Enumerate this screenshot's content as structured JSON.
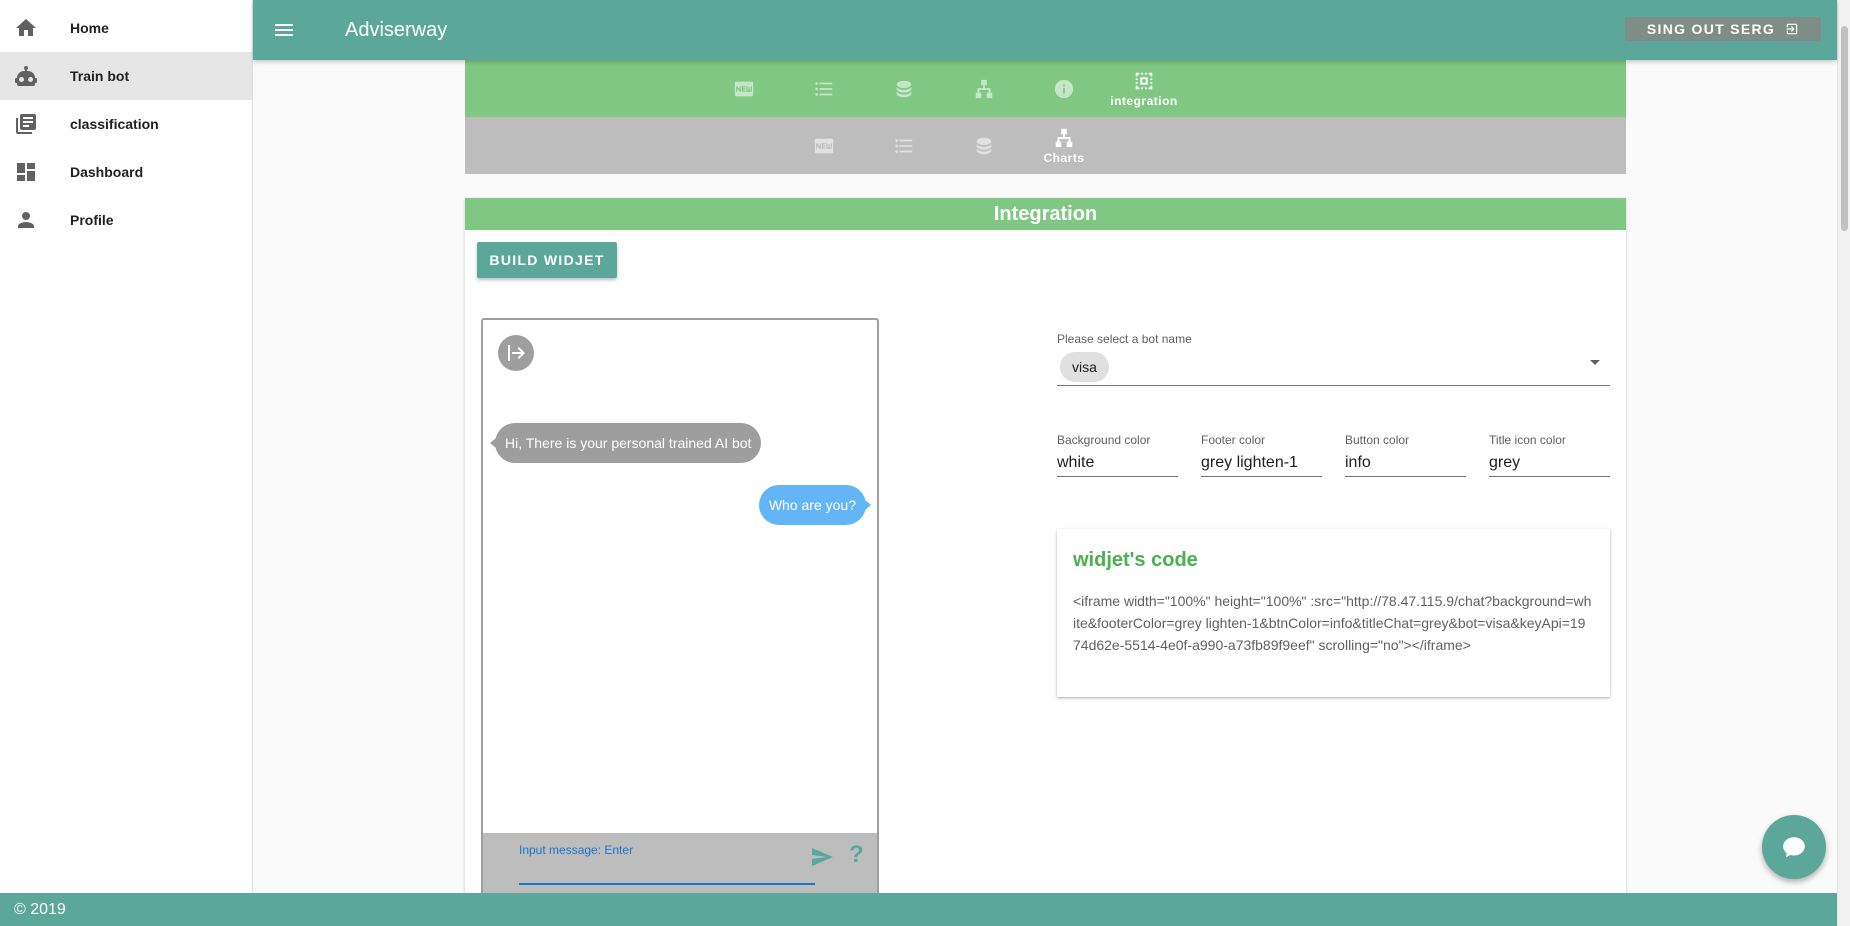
{
  "sidebar": {
    "items": [
      {
        "label": "Home",
        "icon": "home-icon"
      },
      {
        "label": "Train bot",
        "icon": "robot-icon"
      },
      {
        "label": "classification",
        "icon": "library-books-icon"
      },
      {
        "label": "Dashboard",
        "icon": "dashboard-icon"
      },
      {
        "label": "Profile",
        "icon": "person-icon"
      }
    ],
    "active_item": "Train bot"
  },
  "header": {
    "title": "Adviserway",
    "signout_label": "SING OUT SERG"
  },
  "tabs_primary": {
    "items": [
      {
        "icon": "new-icon"
      },
      {
        "icon": "list-icon"
      },
      {
        "icon": "database-icon"
      },
      {
        "icon": "sitemap-icon"
      },
      {
        "icon": "info-icon"
      },
      {
        "icon": "integration-icon",
        "label": "integration"
      }
    ],
    "active": "integration"
  },
  "tabs_secondary": {
    "items": [
      {
        "icon": "new-icon"
      },
      {
        "icon": "list-icon"
      },
      {
        "icon": "database-icon"
      },
      {
        "icon": "sitemap-icon",
        "label": "Charts"
      }
    ],
    "active": "Charts"
  },
  "integration": {
    "title": "Integration",
    "build_button": "BUILD WIDJET",
    "chat": {
      "bot_message": "Hi, There is your personal trained AI bot",
      "user_message": "Who are you?",
      "input_label": "Input message: Enter",
      "input_value": "",
      "help_label": "?"
    },
    "bot_select": {
      "label": "Please select a bot name",
      "value": "visa"
    },
    "fields": [
      {
        "label": "Background color",
        "value": "white"
      },
      {
        "label": "Footer color",
        "value": "grey lighten-1"
      },
      {
        "label": "Button color",
        "value": "info"
      },
      {
        "label": "Title icon color",
        "value": "grey"
      }
    ],
    "code_card": {
      "title": "widjet's code",
      "code": "<iframe width=\"100%\" height=\"100%\" :src=\"http://78.47.115.9/chat?background=white&footerColor=grey lighten-1&btnColor=info&titleChat=grey&bot=visa&keyApi=1974d62e-5514-4e0f-a990-a73fb89f9eef\" scrolling=\"no\"></iframe>"
    }
  },
  "footer": {
    "copyright": "© 2019"
  },
  "colors": {
    "primary": "#5ba89a",
    "tabs_green": "#81c784",
    "tabs_grey": "#bdbdbd",
    "user_bubble": "#64b5f6",
    "bot_bubble": "#9e9e9e",
    "code_title": "#4caf50"
  }
}
